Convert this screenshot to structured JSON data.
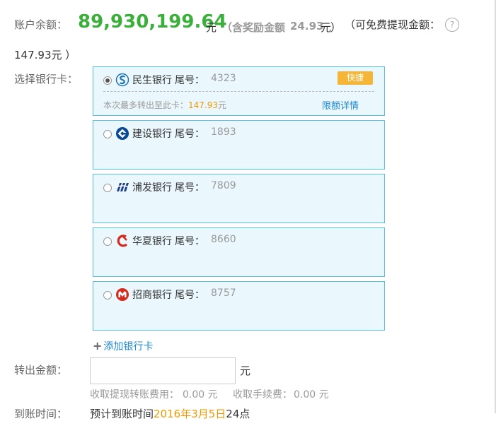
{
  "balance": {
    "label": "账户余额：",
    "amount": "89,930,199.64",
    "unit": "元",
    "reward_open": "（含奖励金额",
    "reward_amount": "24.93",
    "reward_unit": "元",
    "reward_close": "）",
    "free_label": "（可免费提现金额：",
    "free_amount": "147.93元 ）",
    "help_symbol": "?"
  },
  "select_card": {
    "label": "选择银行卡：",
    "tail_label": "尾号：",
    "cards": [
      {
        "bank": "民生银行",
        "tail": "4323",
        "selected": true,
        "logo": "cmbc-logo-icon",
        "badge": "快捷",
        "limit_prefix": "本次最多转出至此卡：",
        "limit_amount": "147.93",
        "limit_unit": "元",
        "limit_link": "限额详情"
      },
      {
        "bank": "建设银行",
        "tail": "1893",
        "selected": false,
        "logo": "ccb-logo-icon"
      },
      {
        "bank": "浦发银行",
        "tail": "7809",
        "selected": false,
        "logo": "spdb-logo-icon"
      },
      {
        "bank": "华夏银行",
        "tail": "8660",
        "selected": false,
        "logo": "hxb-logo-icon"
      },
      {
        "bank": "招商银行",
        "tail": "8757",
        "selected": false,
        "logo": "cmb-logo-icon"
      }
    ],
    "add_card": "添加银行卡",
    "add_symbol": "+"
  },
  "transfer": {
    "label": "转出金额：",
    "value": "",
    "unit": "元",
    "fee1_label": "收取提现转账费用：",
    "fee1_value": "0.00 元",
    "fee2_label": "收取手续费：",
    "fee2_value": "0.00 元"
  },
  "arrival": {
    "label": "到账时间：",
    "prefix": "预计到账时间",
    "date": "2016年3月5日",
    "suffix": "24点"
  },
  "colors": {
    "balance_green": "#3aaf3a",
    "card_border": "#58bde8",
    "card_bg": "#eaf7fd",
    "badge_orange": "#f5b536",
    "link_blue": "#1e88d6",
    "highlight_orange": "#f39800"
  }
}
